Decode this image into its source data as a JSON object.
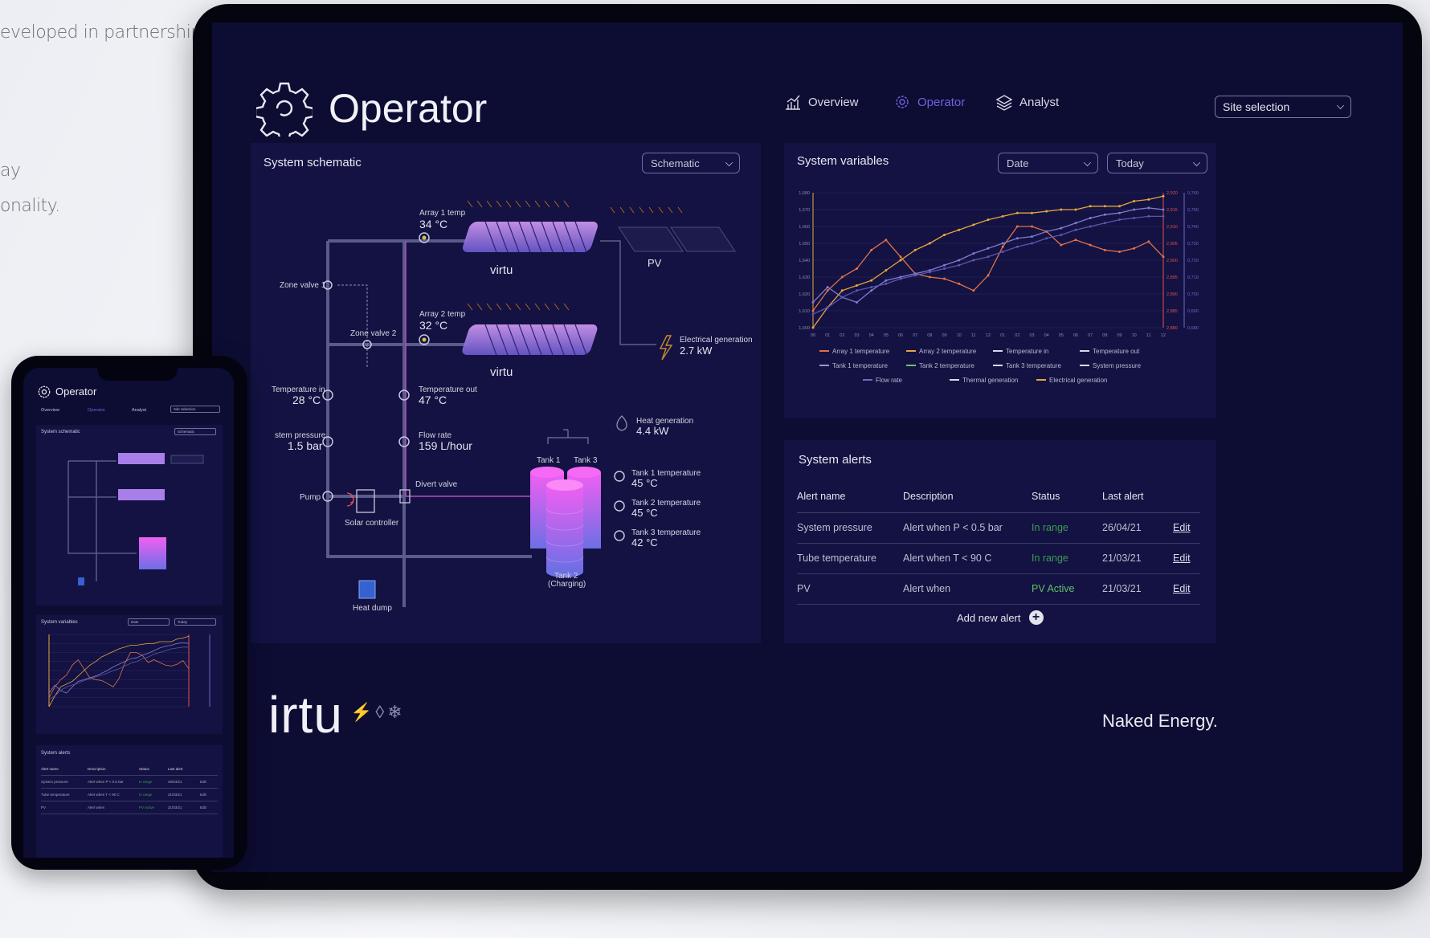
{
  "side_text": {
    "line1": "eveloped in partnership",
    "line2": "ay",
    "line3": "onality."
  },
  "app": {
    "title": "Operator",
    "nav": {
      "overview": "Overview",
      "operator": "Operator",
      "analyst": "Analyst"
    },
    "site_selection": "Site selection"
  },
  "schematic": {
    "title": "System schematic",
    "dropdown": "Schematic",
    "array1_label": "Array 1 temp",
    "array1_value": "34 °C",
    "array2_label": "Array 2 temp",
    "array2_value": "32 °C",
    "pv_label": "PV",
    "virtu1": "virtu",
    "virtu2": "virtu",
    "zone_valve_1": "Zone valve 1",
    "zone_valve_2": "Zone valve 2",
    "elec_gen_label": "Electrical generation",
    "elec_gen_value": "2.7 kW",
    "temp_in_label": "Temperature in",
    "temp_in_value": "28 °C",
    "temp_out_label": "Temperature out",
    "temp_out_value": "47 °C",
    "sys_pressure_label": "stem pressure",
    "sys_pressure_value": "1.5 bar",
    "flow_rate_label": "Flow rate",
    "flow_rate_value": "159 L/hour",
    "heat_gen_label": "Heat generation",
    "heat_gen_value": "4.4 kW",
    "pump_label": "Pump",
    "solar_controller_label": "Solar controller",
    "divert_valve_label": "Divert valve",
    "heat_dump_label": "Heat dump",
    "tank1_label": "Tank 1",
    "tank3_label": "Tank 3",
    "tank2_label": "Tank 2",
    "tank2_sub": "(Charging)",
    "tank1_temp_label": "Tank 1 temperature",
    "tank1_temp_value": "45 °C",
    "tank2_temp_label": "Tank 2 temperature",
    "tank2_temp_value": "45 °C",
    "tank3_temp_label": "Tank 3 temperature",
    "tank3_temp_value": "42 °C"
  },
  "variables": {
    "title": "System variables",
    "dropdown_date": "Date",
    "dropdown_range": "Today"
  },
  "chart_data": {
    "type": "line",
    "x": [
      "00",
      "01",
      "02",
      "03",
      "04",
      "05",
      "06",
      "07",
      "08",
      "09",
      "10",
      "11",
      "12",
      "01",
      "02",
      "03",
      "04",
      "05",
      "06",
      "07",
      "08",
      "09",
      "10",
      "11",
      "12"
    ],
    "ylim": [
      1600,
      1680
    ],
    "y_ticks": [
      "1,680",
      "1,670",
      "1,660",
      "1,650",
      "1,640",
      "1,630",
      "1,620",
      "1,610",
      "1,600"
    ],
    "right_ticks_1": [
      "2,920",
      "2,915",
      "2,910",
      "2,905",
      "2,900",
      "2,895",
      "2,890",
      "2,885",
      "2,880"
    ],
    "right_ticks_2": [
      "0,760",
      "0,750",
      "0,740",
      "0,730",
      "0,720",
      "0,710",
      "0,700",
      "0,690",
      "0,680"
    ],
    "series": [
      {
        "name": "Array 1 temperature",
        "color": "#e0724a",
        "values": [
          1610,
          1622,
          1630,
          1635,
          1646,
          1652,
          1642,
          1632,
          1630,
          1629,
          1626,
          1622,
          1631,
          1648,
          1660,
          1660,
          1657,
          1649,
          1652,
          1649,
          1646,
          1645,
          1647,
          1651,
          1642
        ]
      },
      {
        "name": "Array 2 temperature",
        "color": "#e8a53f",
        "values": [
          1600,
          1612,
          1622,
          1625,
          1628,
          1634,
          1640,
          1646,
          1650,
          1655,
          1658,
          1661,
          1664,
          1666,
          1668,
          1668,
          1669,
          1670,
          1670,
          1672,
          1672,
          1672,
          1675,
          1676,
          1678
        ]
      },
      {
        "name": "Temperature in",
        "color": "#7f7ccf",
        "values": [
          1615,
          1624,
          1618,
          1615,
          1622,
          1628,
          1630,
          1632,
          1634,
          1637,
          1640,
          1644,
          1647,
          1650,
          1653,
          1654,
          1657,
          1659,
          1662,
          1665,
          1667,
          1668,
          1670,
          1671,
          1670
        ]
      },
      {
        "name": "Temperature out",
        "color": "#5a56b0",
        "values": [
          1608,
          1612,
          1618,
          1622,
          1624,
          1626,
          1629,
          1631,
          1633,
          1635,
          1637,
          1640,
          1642,
          1645,
          1648,
          1650,
          1653,
          1655,
          1658,
          1660,
          1662,
          1664,
          1665,
          1666,
          1666
        ]
      }
    ],
    "legend": [
      {
        "name": "Array 1 temperature",
        "color": "#e0724a"
      },
      {
        "name": "Array 2 temperature",
        "color": "#e8a53f"
      },
      {
        "name": "Temperature in",
        "color": "#d8d8e8"
      },
      {
        "name": "Temperature out",
        "color": "#d8d8e8"
      },
      {
        "name": "Tank 1 temperature",
        "color": "#9896d8"
      },
      {
        "name": "Tank 2 temperature",
        "color": "#6ec077"
      },
      {
        "name": "Tank 3 temperature",
        "color": "#d8d8e8"
      },
      {
        "name": "System pressure",
        "color": "#d8d8e8"
      },
      {
        "name": "Flow rate",
        "color": "#6d69c5"
      },
      {
        "name": "Thermal generation",
        "color": "#d8d8e8"
      },
      {
        "name": "Electrical generation",
        "color": "#e8a53f"
      }
    ]
  },
  "alerts": {
    "title": "System alerts",
    "headers": [
      "Alert name",
      "Description",
      "Status",
      "Last alert"
    ],
    "rows": [
      {
        "name": "System pressure",
        "description": "Alert when P < 0.5 bar",
        "status": "In range",
        "last": "26/04/21",
        "action": "Edit"
      },
      {
        "name": "Tube temperature",
        "description": "Alert when T < 90 C",
        "status": "In range",
        "last": "21/03/21",
        "action": "Edit"
      },
      {
        "name": "PV",
        "description": "Alert when",
        "status": "PV Active",
        "last": "21/03/21",
        "action": "Edit"
      }
    ],
    "add_label": "Add new alert"
  },
  "footer": {
    "logo": "irtu",
    "logo_icons": "⚡◊❄",
    "partner": "Naked Energy."
  },
  "phone": {
    "title": "Operator",
    "nav_overview": "Overview",
    "nav_operator": "Operator",
    "nav_analyst": "Analyst",
    "site_selection": "Site Selection",
    "schematic_title": "System schematic",
    "schematic_dropdown": "Schematic",
    "variables_title": "System variables",
    "dd_date": "Date",
    "dd_today": "Today",
    "alerts_title": "System alerts"
  }
}
